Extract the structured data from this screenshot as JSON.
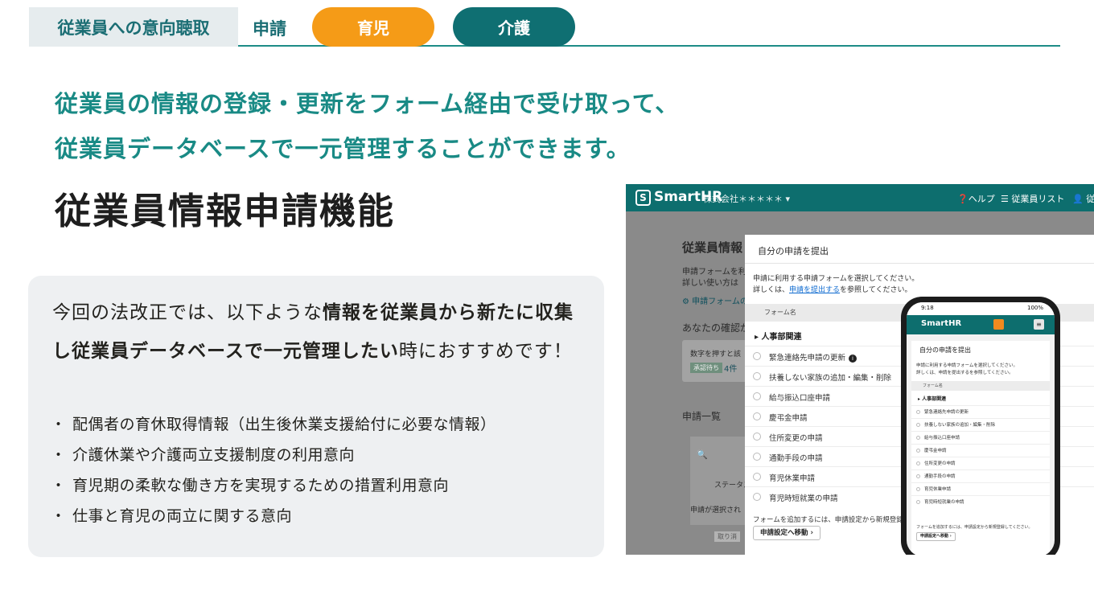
{
  "header": {
    "section_tag": "従業員への意向聴取",
    "crumb": "申請",
    "pills": {
      "childcare": "育児",
      "nursing": "介護"
    }
  },
  "colors": {
    "accent": "#1e8c87",
    "orange": "#f59b17",
    "teal_dark": "#0f6f72"
  },
  "lead": {
    "line1": "従業員の情報の登録・更新をフォーム経由で受け取って、",
    "line2": "従業員データベースで一元管理することができます。"
  },
  "title": "従業員情報申請機能",
  "card": {
    "intro_plain1": "今回の法改正では、以下ような",
    "intro_bold": "情報を従業員から新たに収集し従業員データベースで一元管理したい",
    "intro_plain2": "時におすすめです！",
    "bullet_mark": "・",
    "bullets": [
      "配偶者の育休取得情報（出生後休業支援給付に必要な情報）",
      "介護休業や介護両立支援制度の利用意向",
      "育児期の柔軟な働き方を実現するための措置利用意向",
      "仕事と育児の両立に関する意向"
    ]
  },
  "app": {
    "logo_mark": "S",
    "logo": "SmartHR",
    "company": "株式会社＊＊＊＊＊ ▾",
    "help": "❓ヘルプ",
    "employee_list": "☰ 従業員リスト",
    "user": "👤 従業",
    "bg": {
      "title": "従業員情報",
      "line1": "申請フォームを利用",
      "line2": "詳しい使い方は",
      "line3": "⚙ 申請フォームの",
      "confirm": "あなたの確認が",
      "box_text": "数字を押すと該",
      "box_badge": "承認待ち",
      "box_count": "4件",
      "list_title": "申請一覧",
      "search_icon": "🔍",
      "status": "ステータス",
      "select_note": "申請が選択され",
      "tag": "取り消"
    },
    "modal": {
      "title": "自分の申請を提出",
      "desc1": "申請に利用する申請フォームを選択してください。",
      "desc2_pre": "詳しくは、",
      "desc2_link": "申請を提出する",
      "desc2_post": "を参照してください。",
      "col_header": "フォーム名",
      "category": "▸ 人事部関連",
      "forms": [
        "緊急連絡先申請の更新",
        "扶養しない家族の追加・編集・削除",
        "給与振込口座申請",
        "慶弔金申請",
        "住所変更の申請",
        "通勤手段の申請",
        "育児休業申請",
        "育児時短就業の申請"
      ],
      "info_mark": "i",
      "note": "フォームを追加するには、申請設定から新規登録してくだ",
      "button": "申請設定へ移動 ›"
    },
    "phone": {
      "time": "9:18",
      "battery": "100%",
      "logo": "SmartHR",
      "menu_icon": "≡",
      "title": "自分の申請を提出",
      "desc1": "申請に利用する申請フォームを選択してください。",
      "desc2": "詳しくは、申請を提出するを参照してください。",
      "col_header": "フォーム名",
      "category": "▸ 人事部関連",
      "note": "フォームを追加するには、申請設定から新規登録してください。",
      "button": "申請設定へ移動 ›"
    }
  }
}
